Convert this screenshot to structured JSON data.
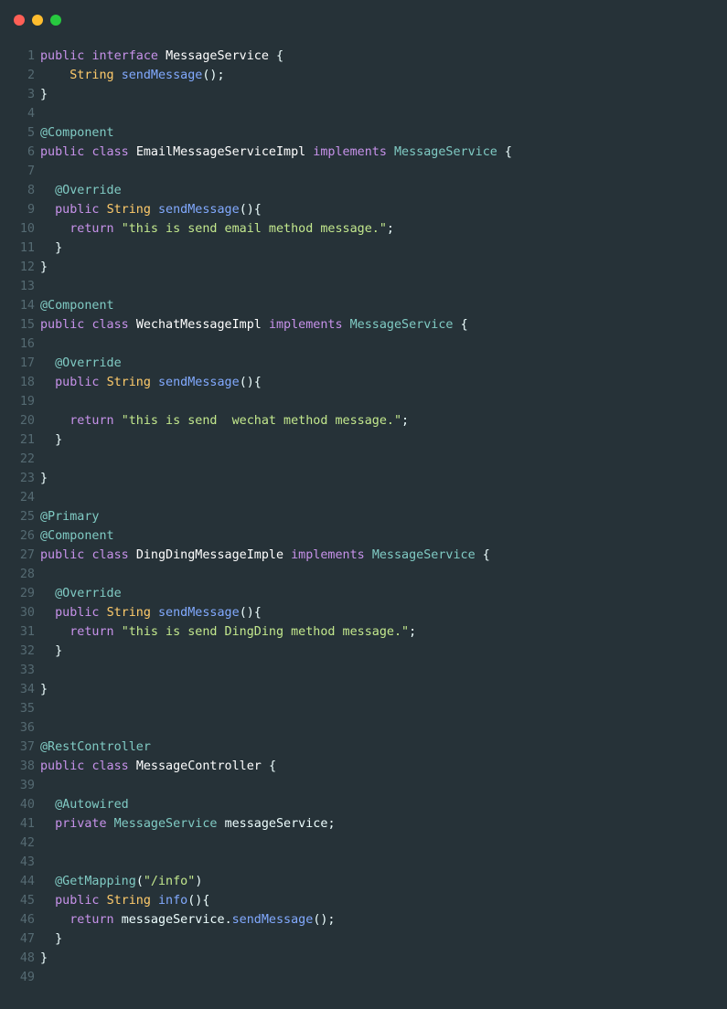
{
  "window": {
    "controls": [
      {
        "name": "close",
        "color": "#ff5f56"
      },
      {
        "name": "minimize",
        "color": "#ffbd2e"
      },
      {
        "name": "maximize",
        "color": "#27c93f"
      }
    ]
  },
  "theme": {
    "background": "#263238",
    "line_number": "#556a72",
    "keyword": "#c792ea",
    "type": "#ffcb6b",
    "function": "#82aaff",
    "annotation": "#80cbc4",
    "string": "#c3e88d",
    "text": "#eeffff"
  },
  "code": {
    "language": "java",
    "lines": [
      {
        "n": "1",
        "tokens": [
          [
            "keyword",
            "public "
          ],
          [
            "keyword",
            "interface "
          ],
          [
            "name",
            "MessageService "
          ],
          [
            "punct",
            "{"
          ]
        ]
      },
      {
        "n": "2",
        "tokens": [
          [
            "plain",
            "    "
          ],
          [
            "type",
            "String "
          ],
          [
            "func",
            "sendMessage"
          ],
          [
            "punct",
            "();"
          ]
        ]
      },
      {
        "n": "3",
        "tokens": [
          [
            "punct",
            "}"
          ]
        ]
      },
      {
        "n": "4",
        "tokens": []
      },
      {
        "n": "5",
        "tokens": [
          [
            "annotation",
            "@Component"
          ]
        ]
      },
      {
        "n": "6",
        "tokens": [
          [
            "keyword",
            "public "
          ],
          [
            "keyword",
            "class "
          ],
          [
            "name",
            "EmailMessageServiceImpl "
          ],
          [
            "keyword",
            "implements "
          ],
          [
            "iface",
            "MessageService "
          ],
          [
            "punct",
            "{"
          ]
        ]
      },
      {
        "n": "7",
        "tokens": []
      },
      {
        "n": "8",
        "tokens": [
          [
            "plain",
            "  "
          ],
          [
            "annotation",
            "@Override"
          ]
        ]
      },
      {
        "n": "9",
        "tokens": [
          [
            "plain",
            "  "
          ],
          [
            "keyword",
            "public "
          ],
          [
            "type",
            "String "
          ],
          [
            "func",
            "sendMessage"
          ],
          [
            "punct",
            "(){"
          ]
        ]
      },
      {
        "n": "10",
        "tokens": [
          [
            "plain",
            "    "
          ],
          [
            "keyword",
            "return "
          ],
          [
            "string",
            "\"this is send email method message.\""
          ],
          [
            "punct",
            ";"
          ]
        ]
      },
      {
        "n": "11",
        "tokens": [
          [
            "plain",
            "  "
          ],
          [
            "punct",
            "}"
          ]
        ]
      },
      {
        "n": "12",
        "tokens": [
          [
            "punct",
            "}"
          ]
        ]
      },
      {
        "n": "13",
        "tokens": []
      },
      {
        "n": "14",
        "tokens": [
          [
            "annotation",
            "@Component"
          ]
        ]
      },
      {
        "n": "15",
        "tokens": [
          [
            "keyword",
            "public "
          ],
          [
            "keyword",
            "class "
          ],
          [
            "name",
            "WechatMessageImpl "
          ],
          [
            "keyword",
            "implements "
          ],
          [
            "iface",
            "MessageService "
          ],
          [
            "punct",
            "{"
          ]
        ]
      },
      {
        "n": "16",
        "tokens": []
      },
      {
        "n": "17",
        "tokens": [
          [
            "plain",
            "  "
          ],
          [
            "annotation",
            "@Override"
          ]
        ]
      },
      {
        "n": "18",
        "tokens": [
          [
            "plain",
            "  "
          ],
          [
            "keyword",
            "public "
          ],
          [
            "type",
            "String "
          ],
          [
            "func",
            "sendMessage"
          ],
          [
            "punct",
            "(){"
          ]
        ]
      },
      {
        "n": "19",
        "tokens": []
      },
      {
        "n": "20",
        "tokens": [
          [
            "plain",
            "    "
          ],
          [
            "keyword",
            "return "
          ],
          [
            "string",
            "\"this is send  wechat method message.\""
          ],
          [
            "punct",
            ";"
          ]
        ]
      },
      {
        "n": "21",
        "tokens": [
          [
            "plain",
            "  "
          ],
          [
            "punct",
            "}"
          ]
        ]
      },
      {
        "n": "22",
        "tokens": []
      },
      {
        "n": "23",
        "tokens": [
          [
            "punct",
            "}"
          ]
        ]
      },
      {
        "n": "24",
        "tokens": []
      },
      {
        "n": "25",
        "tokens": [
          [
            "annotation",
            "@Primary"
          ]
        ]
      },
      {
        "n": "26",
        "tokens": [
          [
            "annotation",
            "@Component"
          ]
        ]
      },
      {
        "n": "27",
        "tokens": [
          [
            "keyword",
            "public "
          ],
          [
            "keyword",
            "class "
          ],
          [
            "name",
            "DingDingMessageImple "
          ],
          [
            "keyword",
            "implements "
          ],
          [
            "iface",
            "MessageService "
          ],
          [
            "punct",
            "{"
          ]
        ]
      },
      {
        "n": "28",
        "tokens": []
      },
      {
        "n": "29",
        "tokens": [
          [
            "plain",
            "  "
          ],
          [
            "annotation",
            "@Override"
          ]
        ]
      },
      {
        "n": "30",
        "tokens": [
          [
            "plain",
            "  "
          ],
          [
            "keyword",
            "public "
          ],
          [
            "type",
            "String "
          ],
          [
            "func",
            "sendMessage"
          ],
          [
            "punct",
            "(){"
          ]
        ]
      },
      {
        "n": "31",
        "tokens": [
          [
            "plain",
            "    "
          ],
          [
            "keyword",
            "return "
          ],
          [
            "string",
            "\"this is send DingDing method message.\""
          ],
          [
            "punct",
            ";"
          ]
        ]
      },
      {
        "n": "32",
        "tokens": [
          [
            "plain",
            "  "
          ],
          [
            "punct",
            "}"
          ]
        ]
      },
      {
        "n": "33",
        "tokens": []
      },
      {
        "n": "34",
        "tokens": [
          [
            "punct",
            "}"
          ]
        ]
      },
      {
        "n": "35",
        "tokens": []
      },
      {
        "n": "36",
        "tokens": []
      },
      {
        "n": "37",
        "tokens": [
          [
            "annotation",
            "@RestController"
          ]
        ]
      },
      {
        "n": "38",
        "tokens": [
          [
            "keyword",
            "public "
          ],
          [
            "keyword",
            "class "
          ],
          [
            "name",
            "MessageController "
          ],
          [
            "punct",
            "{"
          ]
        ]
      },
      {
        "n": "39",
        "tokens": []
      },
      {
        "n": "40",
        "tokens": [
          [
            "plain",
            "  "
          ],
          [
            "annotation",
            "@Autowired"
          ]
        ]
      },
      {
        "n": "41",
        "tokens": [
          [
            "plain",
            "  "
          ],
          [
            "keyword",
            "private "
          ],
          [
            "iface",
            "MessageService "
          ],
          [
            "plain",
            "messageService"
          ],
          [
            "punct",
            ";"
          ]
        ]
      },
      {
        "n": "42",
        "tokens": []
      },
      {
        "n": "43",
        "tokens": []
      },
      {
        "n": "44",
        "tokens": [
          [
            "plain",
            "  "
          ],
          [
            "annotation",
            "@GetMapping"
          ],
          [
            "punct",
            "("
          ],
          [
            "string",
            "\"/info\""
          ],
          [
            "punct",
            ")"
          ]
        ]
      },
      {
        "n": "45",
        "tokens": [
          [
            "plain",
            "  "
          ],
          [
            "keyword",
            "public "
          ],
          [
            "type",
            "String "
          ],
          [
            "func",
            "info"
          ],
          [
            "punct",
            "(){"
          ]
        ]
      },
      {
        "n": "46",
        "tokens": [
          [
            "plain",
            "    "
          ],
          [
            "keyword",
            "return "
          ],
          [
            "plain",
            "messageService"
          ],
          [
            "punct",
            "."
          ],
          [
            "func",
            "sendMessage"
          ],
          [
            "punct",
            "();"
          ]
        ]
      },
      {
        "n": "47",
        "tokens": [
          [
            "plain",
            "  "
          ],
          [
            "punct",
            "}"
          ]
        ]
      },
      {
        "n": "48",
        "tokens": [
          [
            "punct",
            "}"
          ]
        ]
      },
      {
        "n": "49",
        "tokens": []
      }
    ]
  }
}
